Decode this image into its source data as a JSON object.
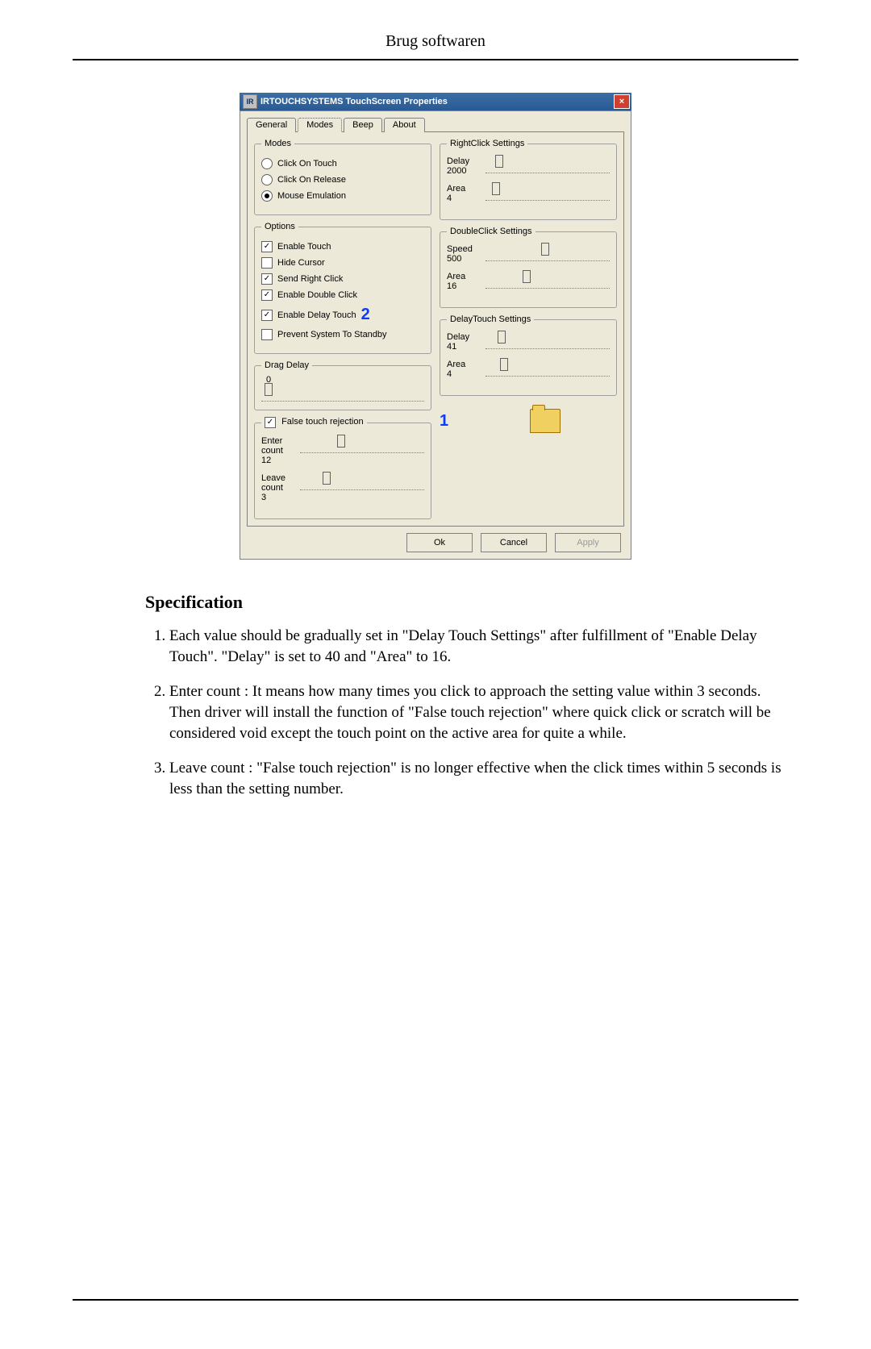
{
  "page_header": "Brug softwaren",
  "section_title": "Specification",
  "spec_items": [
    "Each value should be gradually set in \"Delay Touch Settings\" after fulfillment of \"Enable Delay Touch\". \"Delay\" is set to 40 and \"Area\" to 16.",
    "Enter count : It means how many times you click to approach the setting value within 3 seconds. Then driver will install the function of \"False touch rejection\" where quick click or scratch will be considered void except the touch point on the active area for quite a while.",
    "Leave count : \"False touch rejection\" is no longer effective when the click times within 5 seconds is less than the setting number."
  ],
  "dialog": {
    "app_icon": "IR",
    "title": "IRTOUCHSYSTEMS TouchScreen Properties",
    "tabs": [
      "General",
      "Modes",
      "Beep",
      "About"
    ],
    "active_tab": "Modes",
    "modes": {
      "legend": "Modes",
      "items": [
        "Click On Touch",
        "Click On Release",
        "Mouse Emulation"
      ],
      "selected": "Mouse Emulation"
    },
    "options": {
      "legend": "Options",
      "items": [
        {
          "label": "Enable Touch",
          "checked": true
        },
        {
          "label": "Hide Cursor",
          "checked": false
        },
        {
          "label": "Send Right Click",
          "checked": true
        },
        {
          "label": "Enable Double Click",
          "checked": true
        },
        {
          "label": "Enable Delay Touch",
          "checked": true
        },
        {
          "label": "Prevent System To Standby",
          "checked": false
        }
      ],
      "annotation_2": "2"
    },
    "drag_delay": {
      "legend": "Drag Delay",
      "value": "0"
    },
    "false_touch": {
      "legend": "False touch rejection",
      "checked": true,
      "enter_label": "Enter count",
      "enter_value": "12",
      "leave_label": "Leave count",
      "leave_value": "3"
    },
    "rightclick": {
      "legend": "RightClick Settings",
      "delay_label": "Delay",
      "delay_value": "2000",
      "area_label": "Area",
      "area_value": "4"
    },
    "doubleclick": {
      "legend": "DoubleClick Settings",
      "speed_label": "Speed",
      "speed_value": "500",
      "area_label": "Area",
      "area_value": "16"
    },
    "delaytouch": {
      "legend": "DelayTouch Settings",
      "delay_label": "Delay",
      "delay_value": "41",
      "area_label": "Area",
      "area_value": "4"
    },
    "annotation_1": "1",
    "buttons": {
      "ok": "Ok",
      "cancel": "Cancel",
      "apply": "Apply"
    }
  },
  "chart_data": {
    "type": "table",
    "settings": [
      {
        "group": "RightClick Settings",
        "Delay": 2000,
        "Area": 4
      },
      {
        "group": "DoubleClick Settings",
        "Speed": 500,
        "Area": 16
      },
      {
        "group": "DelayTouch Settings",
        "Delay": 41,
        "Area": 4
      },
      {
        "group": "Drag Delay",
        "value": 0
      },
      {
        "group": "False touch rejection",
        "Enter count": 12,
        "Leave count": 3
      }
    ]
  }
}
